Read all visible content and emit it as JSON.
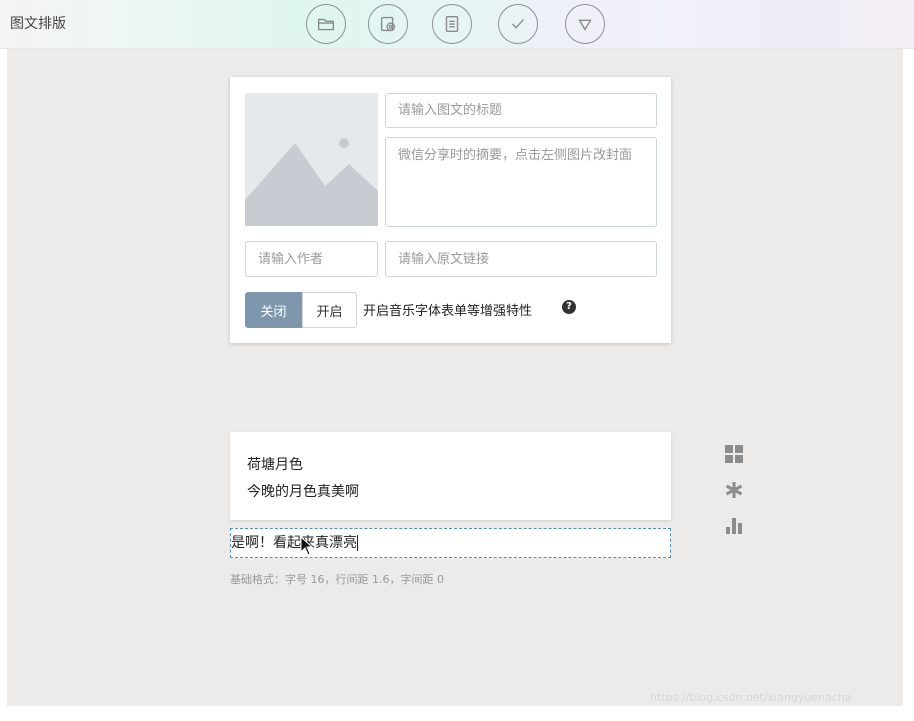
{
  "app": {
    "title": "图文排版"
  },
  "toolbar": {
    "buttons": [
      "folder-icon",
      "media-icon",
      "document-icon",
      "check-icon",
      "triangle-down-icon"
    ]
  },
  "meta_card": {
    "title_placeholder": "请输入图文的标题",
    "summary_placeholder": "微信分享时的摘要，点击左侧图片改封面",
    "author_placeholder": "请输入作者",
    "link_placeholder": "请输入原文链接",
    "toggle_off_label": "关闭",
    "toggle_on_label": "开启",
    "feature_text": "开启音乐字体表单等增强特性",
    "help_glyph": "?"
  },
  "article": {
    "line1": "荷塘月色",
    "line2": "今晚的月色真美啊"
  },
  "editor": {
    "current_text": "是啊！看起来真漂亮",
    "hint": "基础格式：字号 16，行间距 1.6，字间距 0"
  },
  "side_tools": [
    "grid-icon",
    "asterisk-icon",
    "bar-chart-icon"
  ],
  "watermark": "https://blog.csdn.net/xiangyuenacha",
  "colors": {
    "workspace_bg": "#ecebea",
    "toggle_active": "#7f97ac",
    "edit_border": "#4a90c8"
  }
}
